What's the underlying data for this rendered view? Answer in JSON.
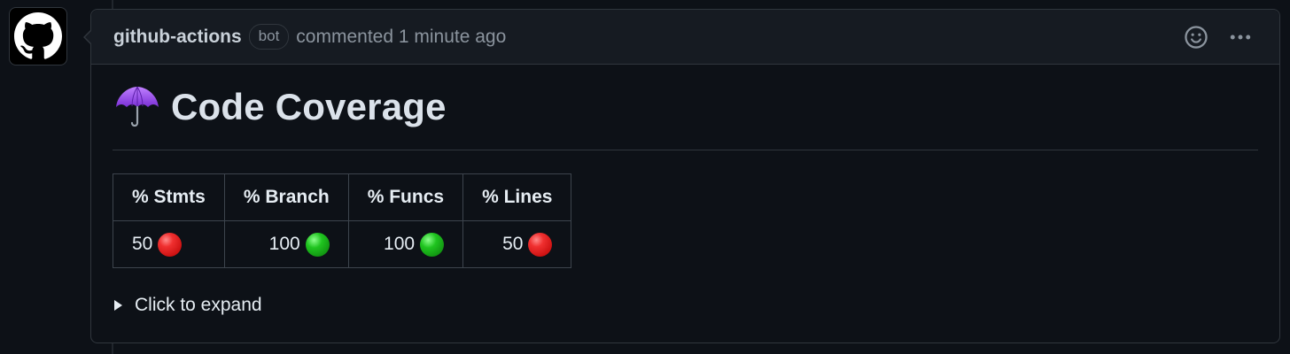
{
  "comment": {
    "author": "github-actions",
    "badge": "bot",
    "timestamp": "commented 1 minute ago",
    "icons": {
      "avatar": "github-octocat-icon",
      "reaction": "smiley-icon",
      "menu": "kebab-horizontal-icon",
      "heading": "umbrella-icon",
      "expand": "triangle-right-icon"
    }
  },
  "body": {
    "heading": "Code Coverage",
    "table": {
      "headers": [
        "% Stmts",
        "% Branch",
        "% Funcs",
        "% Lines"
      ],
      "rows": [
        [
          {
            "value": "50",
            "status": "red"
          },
          {
            "value": "100",
            "status": "green"
          },
          {
            "value": "100",
            "status": "green"
          },
          {
            "value": "50",
            "status": "red"
          }
        ]
      ]
    },
    "details_summary": "Click to expand"
  },
  "colors": {
    "background": "#0d1117",
    "header_bg": "#161b22",
    "border": "#30363d",
    "muted_text": "#8b949e",
    "status_red": "#f03030",
    "status_green": "#1fc41f"
  }
}
